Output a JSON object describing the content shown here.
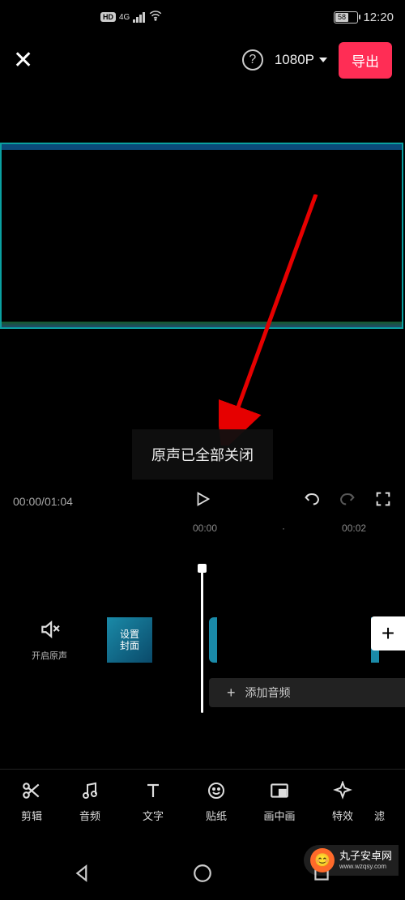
{
  "status": {
    "battery": "58",
    "time": "12:20",
    "network": "4G",
    "hd": "HD"
  },
  "top": {
    "resolution": "1080P",
    "export": "导出"
  },
  "toast": "原声已全部关闭",
  "controls": {
    "current": "00:00",
    "total": "01:04"
  },
  "ruler": {
    "t0": "00:00",
    "t1": "00:02"
  },
  "mute": {
    "label": "开启原声"
  },
  "cover": {
    "label": "设置\n封面"
  },
  "audio": {
    "label": "添加音频",
    "plus": "+"
  },
  "tools": [
    {
      "label": "剪辑"
    },
    {
      "label": "音频"
    },
    {
      "label": "文字"
    },
    {
      "label": "贴纸"
    },
    {
      "label": "画中画"
    },
    {
      "label": "特效"
    },
    {
      "label": "滤"
    }
  ],
  "watermark": {
    "brand": "丸子安卓网",
    "url": "www.wzqsy.com"
  }
}
